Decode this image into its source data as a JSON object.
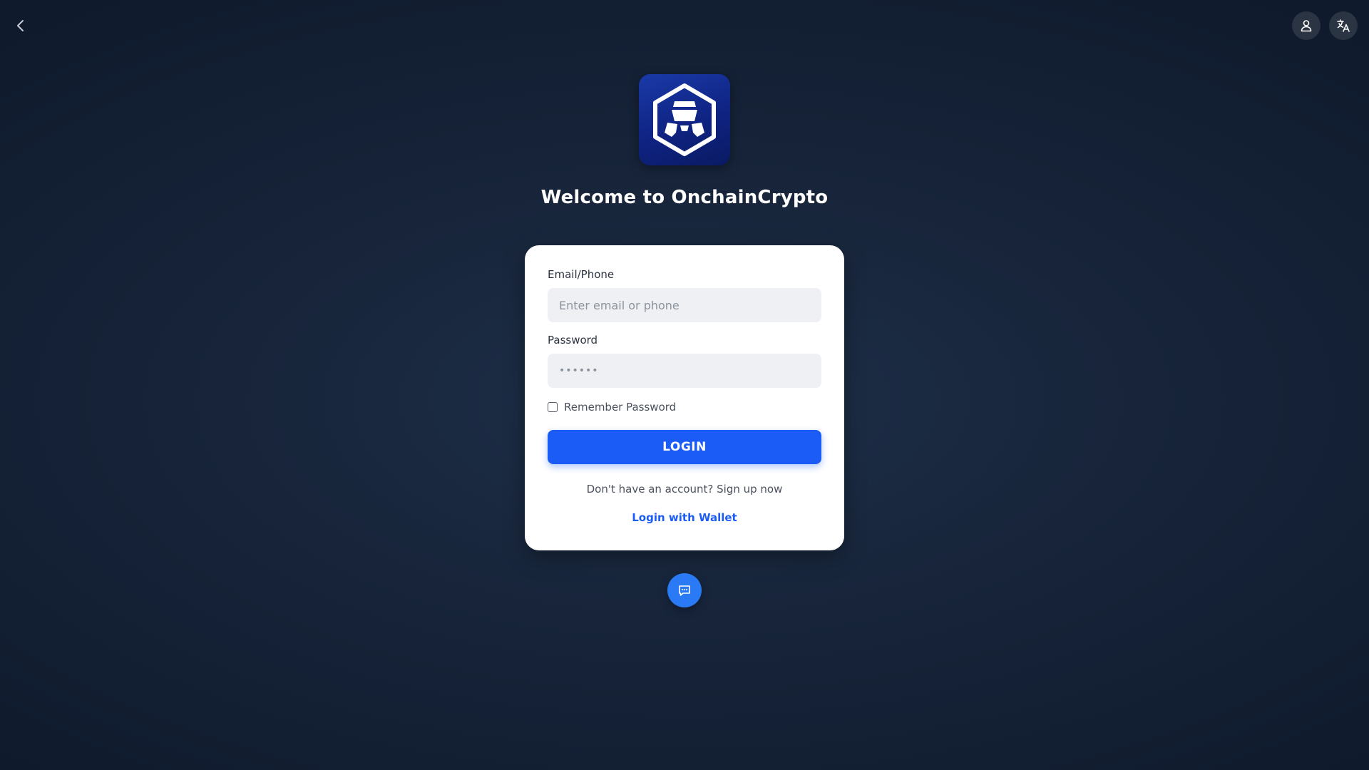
{
  "app": {
    "title": "Welcome to OnchainCrypto"
  },
  "header": {
    "back_icon": "chevron-left-icon",
    "user_icon": "user-icon",
    "language_icon": "translate-icon"
  },
  "logo": {
    "icon": "crypto-shield-logo",
    "color": "#0f2382"
  },
  "form": {
    "email_label": "Email/Phone",
    "email_placeholder": "Enter email or phone",
    "email_value": "",
    "password_label": "Password",
    "password_value": "••••••",
    "remember_label": "Remember Password",
    "remember_checked": false,
    "login_label": "LOGIN",
    "signup_text": "Don't have an account? Sign up now",
    "wallet_text": "Login with Wallet"
  },
  "support": {
    "chat_icon": "chat-bubble-icon"
  },
  "colors": {
    "accent": "#1a5cf5",
    "chat": "#2a7af5",
    "background": "#17243a"
  }
}
